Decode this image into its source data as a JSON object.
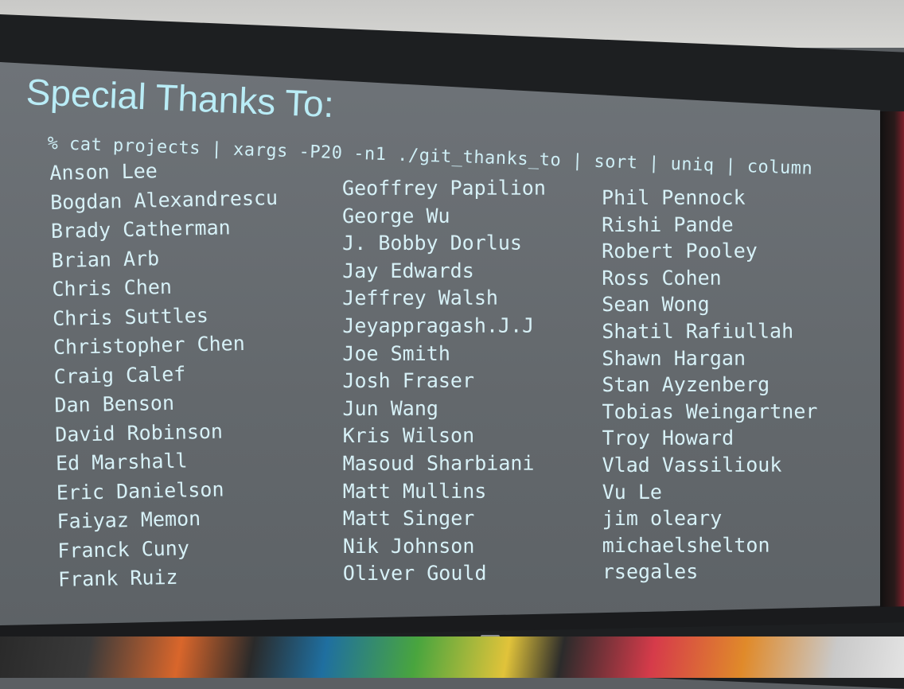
{
  "slide": {
    "heading": "Special Thanks To:",
    "command": "% cat projects | xargs -P20 -n1 ./git_thanks_to  | sort | uniq | column",
    "columns": [
      [
        "Anson Lee",
        "Bogdan Alexandrescu",
        "Brady Catherman",
        "Brian Arb",
        "Chris Chen",
        "Chris Suttles",
        "Christopher Chen",
        "Craig Calef",
        "Dan Benson",
        "David Robinson",
        "Ed Marshall",
        "Eric Danielson",
        "Faiyaz Memon",
        "Franck Cuny",
        "Frank Ruiz"
      ],
      [
        "Geoffrey Papilion",
        "George Wu",
        "J. Bobby Dorlus",
        "Jay Edwards",
        "Jeffrey Walsh",
        "Jeyappragash.J.J",
        "Joe Smith",
        "Josh Fraser",
        "Jun Wang",
        "Kris Wilson",
        "Masoud Sharbiani",
        "Matt Mullins",
        "Matt Singer",
        "Nik Johnson",
        "Oliver Gould"
      ],
      [
        "Phil Pennock",
        "Rishi Pande",
        "Robert Pooley",
        "Ross Cohen",
        "Sean Wong",
        "Shatil Rafiullah",
        "Shawn Hargan",
        "Stan Ayzenberg",
        "Tobias Weingartner",
        "Troy Howard",
        "Vlad Vassiliouk",
        "Vu Le",
        "jim oleary",
        "michaelshelton",
        "rsegales"
      ]
    ]
  },
  "colors": {
    "text": "#d7f1f7",
    "heading": "#b9ecf6",
    "slide_background": "#676c70",
    "frame": "#1d1f21"
  }
}
